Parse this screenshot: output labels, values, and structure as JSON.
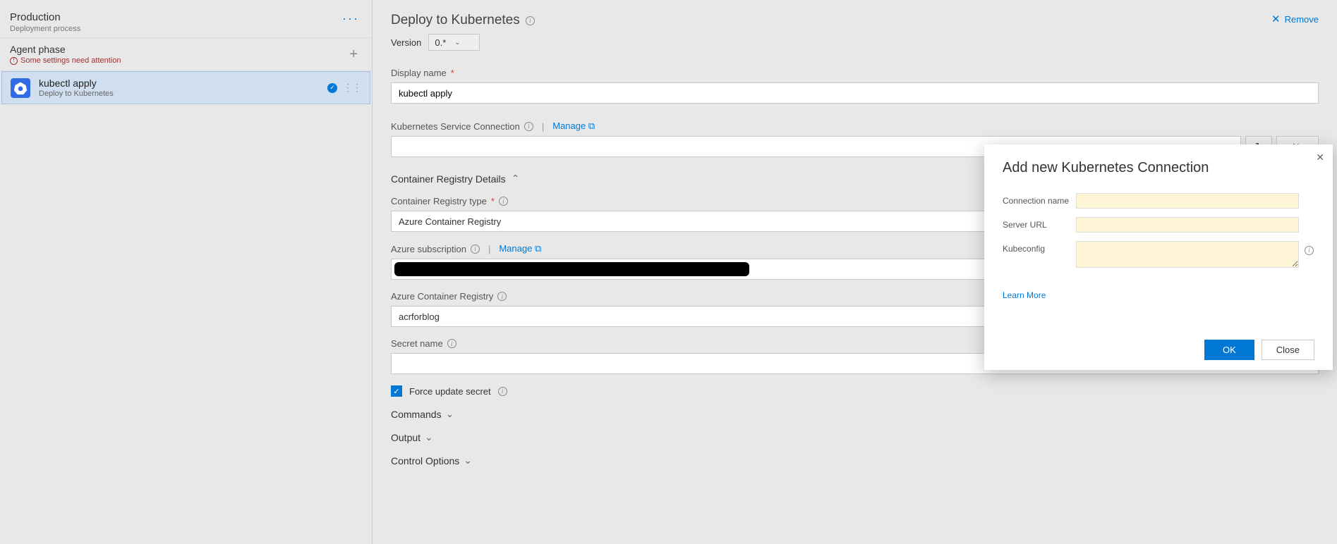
{
  "left": {
    "process_title": "Production",
    "process_subtitle": "Deployment process",
    "agent_phase_title": "Agent phase",
    "agent_phase_warning": "Some settings need attention",
    "task": {
      "name": "kubectl apply",
      "subtitle": "Deploy to Kubernetes"
    }
  },
  "right": {
    "title": "Deploy to Kubernetes",
    "remove_label": "Remove",
    "version_label": "Version",
    "version_value": "0.*",
    "display_name_label": "Display name",
    "display_name_value": "kubectl apply",
    "ksc_label": "Kubernetes Service Connection",
    "manage_label": "Manage",
    "new_label": "New",
    "cr_details_label": "Container Registry Details",
    "cr_type_label": "Container Registry type",
    "cr_type_value": "Azure Container Registry",
    "az_sub_label": "Azure subscription",
    "acr_label": "Azure Container Registry",
    "acr_value": "acrforblog",
    "secret_label": "Secret name",
    "force_update_label": "Force update secret",
    "commands_label": "Commands",
    "output_label": "Output",
    "control_options_label": "Control Options"
  },
  "dialog": {
    "title": "Add new Kubernetes Connection",
    "conn_name_label": "Connection name",
    "server_url_label": "Server URL",
    "kubeconfig_label": "Kubeconfig",
    "learn_more_label": "Learn More",
    "ok_label": "OK",
    "close_label": "Close"
  }
}
